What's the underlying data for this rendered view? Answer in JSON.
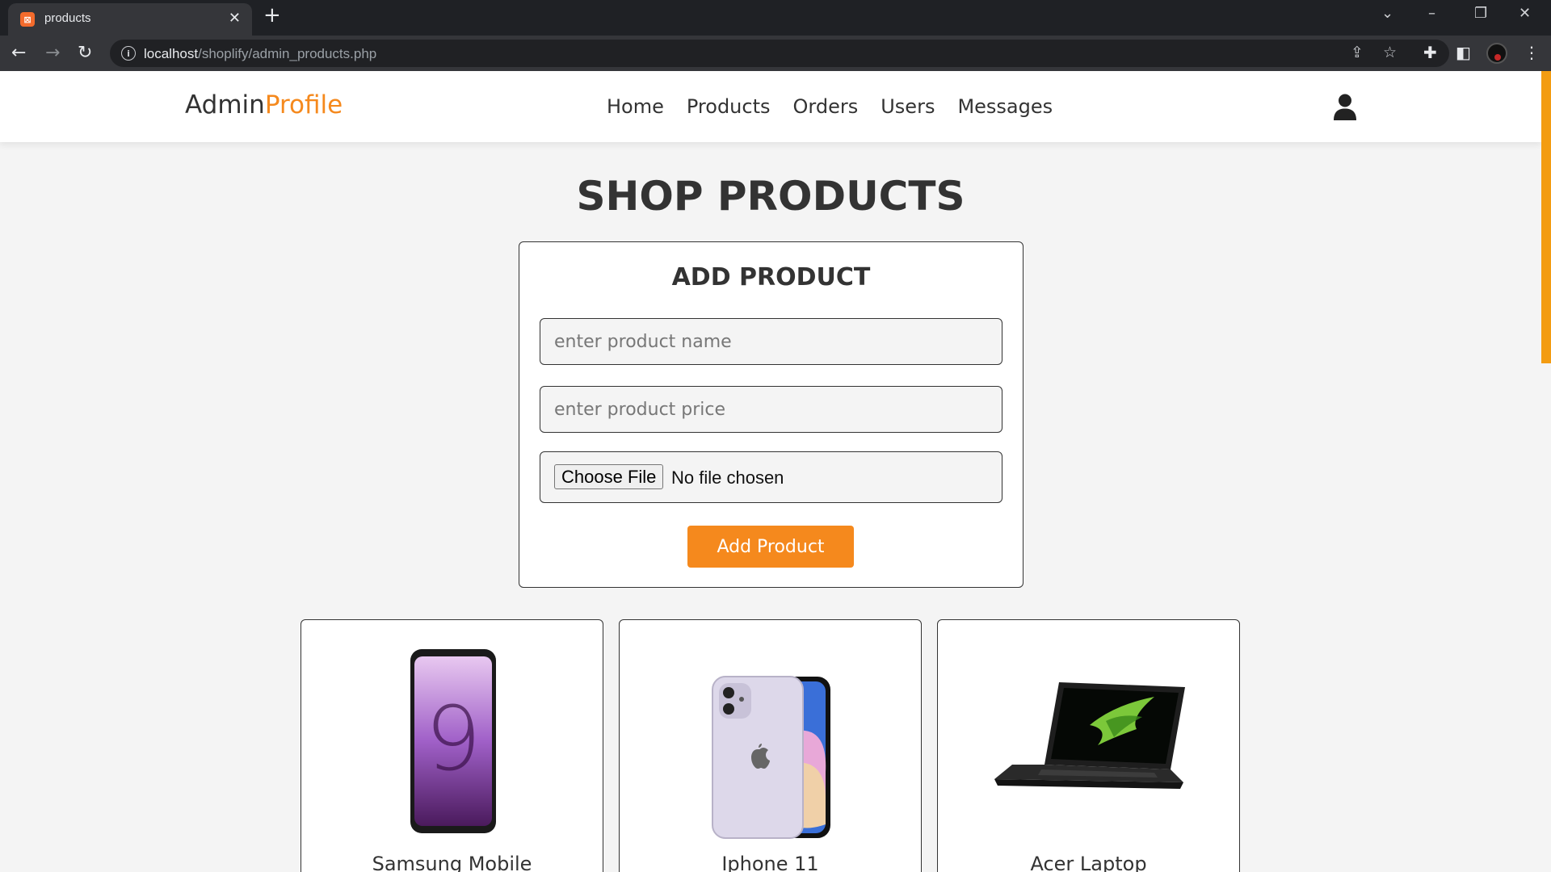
{
  "browser": {
    "tab_title": "products",
    "tab_favicon": "xampp-icon",
    "url_host": "localhost",
    "url_path": "/shoplify/admin_products.php"
  },
  "header": {
    "logo_main": "Admin",
    "logo_accent": "Profile",
    "nav": [
      "Home",
      "Products",
      "Orders",
      "Users",
      "Messages"
    ],
    "user_icon": "user-icon"
  },
  "page": {
    "title": "SHOP PRODUCTS"
  },
  "form": {
    "title": "ADD PRODUCT",
    "name_placeholder": "enter product name",
    "price_placeholder": "enter product price",
    "file_button": "Choose File",
    "file_status": "No file chosen",
    "submit_label": "Add Product"
  },
  "products": [
    {
      "name": "Samsung Mobile"
    },
    {
      "name": "Iphone 11"
    },
    {
      "name": "Acer Laptop"
    }
  ],
  "colors": {
    "accent": "#f5891d",
    "text": "#333333",
    "background": "#f4f4f4"
  }
}
